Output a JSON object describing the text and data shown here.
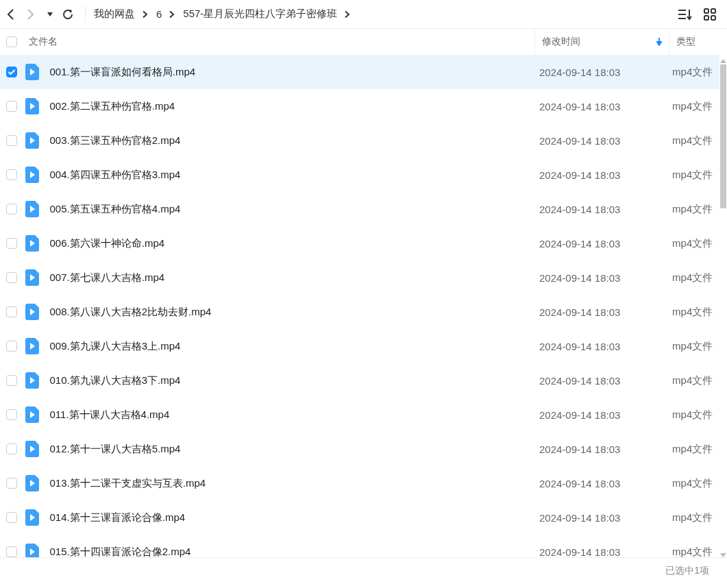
{
  "breadcrumb": [
    {
      "label": "我的网盘"
    },
    {
      "label": "6"
    },
    {
      "label": "557-星月辰光四柱八字弟子密修班"
    }
  ],
  "select_all": {
    "checked": false
  },
  "columns": [
    {
      "label": "文件名",
      "sorted": false
    },
    {
      "label": "修改时间",
      "sorted": true
    },
    {
      "label": "类型",
      "sorted": false
    }
  ],
  "rows": [
    {
      "name": "001.第一课盲派如何看格局.mp4",
      "modified": "2024-09-14 18:03",
      "type": "mp4文件",
      "selected": true
    },
    {
      "name": "002.第二课五种伤官格.mp4",
      "modified": "2024-09-14 18:03",
      "type": "mp4文件",
      "selected": false
    },
    {
      "name": "003.第三课五种伤官格2.mp4",
      "modified": "2024-09-14 18:03",
      "type": "mp4文件",
      "selected": false
    },
    {
      "name": "004.第四课五种伤官格3.mp4",
      "modified": "2024-09-14 18:03",
      "type": "mp4文件",
      "selected": false
    },
    {
      "name": "005.第五课五种伤官格4.mp4",
      "modified": "2024-09-14 18:03",
      "type": "mp4文件",
      "selected": false
    },
    {
      "name": "006.第六课十神论命.mp4",
      "modified": "2024-09-14 18:03",
      "type": "mp4文件",
      "selected": false
    },
    {
      "name": "007.第七课八大吉格.mp4",
      "modified": "2024-09-14 18:03",
      "type": "mp4文件",
      "selected": false
    },
    {
      "name": "008.第八课八大吉格2比劫去财.mp4",
      "modified": "2024-09-14 18:03",
      "type": "mp4文件",
      "selected": false
    },
    {
      "name": "009.第九课八大吉格3上.mp4",
      "modified": "2024-09-14 18:03",
      "type": "mp4文件",
      "selected": false
    },
    {
      "name": "010.第九课八大吉格3下.mp4",
      "modified": "2024-09-14 18:03",
      "type": "mp4文件",
      "selected": false
    },
    {
      "name": "011.第十课八大吉格4.mp4",
      "modified": "2024-09-14 18:03",
      "type": "mp4文件",
      "selected": false
    },
    {
      "name": "012.第十一课八大吉格5.mp4",
      "modified": "2024-09-14 18:03",
      "type": "mp4文件",
      "selected": false
    },
    {
      "name": "013.第十二课干支虚实与互表.mp4",
      "modified": "2024-09-14 18:03",
      "type": "mp4文件",
      "selected": false
    },
    {
      "name": "014.第十三课盲派论合像.mp4",
      "modified": "2024-09-14 18:03",
      "type": "mp4文件",
      "selected": false
    },
    {
      "name": "015.第十四课盲派论合像2.mp4",
      "modified": "2024-09-14 18:03",
      "type": "mp4文件",
      "selected": false
    }
  ],
  "status_bar": {
    "text": "已选中1项"
  }
}
